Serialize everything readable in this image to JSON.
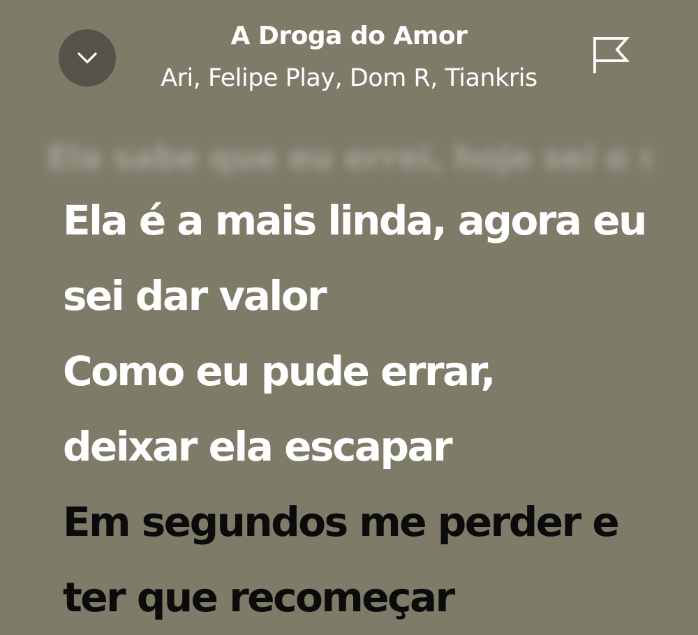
{
  "header": {
    "collapse_icon": "chevron-down-icon",
    "title": "A Droga do Amor",
    "artists": "Ari, Felipe Play, Dom R, Tiankris",
    "report_icon": "flag-icon"
  },
  "lyrics": {
    "previous_line_faded": "Ela sabe que eu errei, hoje sei o seu valor",
    "lines": [
      {
        "text": "Ela é a mais linda, agora eu",
        "state": "past"
      },
      {
        "text": "sei dar valor",
        "state": "past"
      },
      {
        "text": "Como eu pude errar,",
        "state": "past"
      },
      {
        "text": "deixar ela escapar",
        "state": "past"
      },
      {
        "text": "Em segundos me perder e",
        "state": "upcoming"
      },
      {
        "text": "ter que recomeçar",
        "state": "upcoming"
      }
    ]
  },
  "colors": {
    "background": "#7e7b69",
    "button_bg": "#56524a",
    "sung_text": "#ffffff",
    "upcoming_text": "#0b0b0b"
  }
}
